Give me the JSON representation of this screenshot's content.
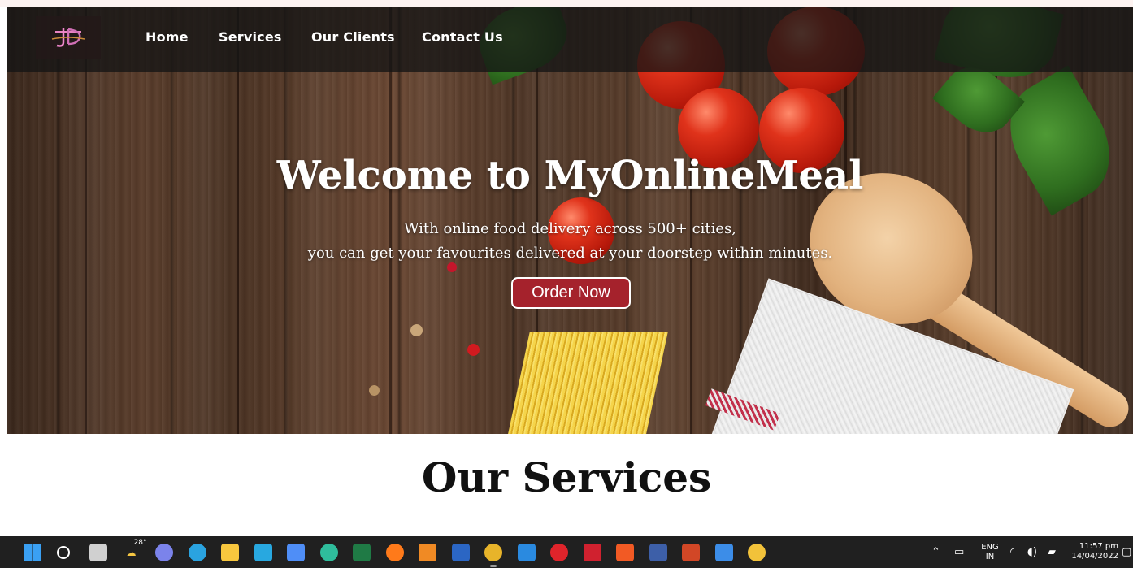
{
  "nav": {
    "items": [
      {
        "label": "Home"
      },
      {
        "label": "Services"
      },
      {
        "label": "Our Clients"
      },
      {
        "label": "Contact Us"
      }
    ]
  },
  "hero": {
    "title": "Welcome to MyOnlineMeal",
    "line1": "With online food delivery across 500+ cities,",
    "line2": "you can get your favourites delivered at your doorstep within minutes.",
    "cta_label": "Order Now"
  },
  "services": {
    "title": "Our Services"
  },
  "taskbar": {
    "weather_temp": "28°",
    "language_line1": "ENG",
    "language_line2": "IN",
    "time": "11:57 pm",
    "date": "14/04/2022",
    "apps": [
      {
        "icon": "windows-start-icon",
        "color": "#3aa0f3"
      },
      {
        "icon": "search-icon",
        "color": "#ffffff"
      },
      {
        "icon": "task-view-icon",
        "color": "#d0d0d0"
      },
      {
        "icon": "weather-icon",
        "color": "#f4c542"
      },
      {
        "icon": "chat-icon",
        "color": "#7b83eb"
      },
      {
        "icon": "telegram-icon",
        "color": "#2aa3e0"
      },
      {
        "icon": "file-explorer-icon",
        "color": "#f8c73e"
      },
      {
        "icon": "vscode-insiders-icon",
        "color": "#28a8e0"
      },
      {
        "icon": "store-icon",
        "color": "#4f8ef7"
      },
      {
        "icon": "edge-icon",
        "color": "#2fbd9c"
      },
      {
        "icon": "excel-icon",
        "color": "#1f7a45"
      },
      {
        "icon": "firefox-icon",
        "color": "#ff7a1a"
      },
      {
        "icon": "sublime-icon",
        "color": "#f08a24"
      },
      {
        "icon": "word-icon",
        "color": "#2b66c4"
      },
      {
        "icon": "chrome-dev-icon",
        "color": "#e8b42a"
      },
      {
        "icon": "vscode-icon",
        "color": "#2a8ae0"
      },
      {
        "icon": "opera-icon",
        "color": "#e0242b"
      },
      {
        "icon": "mcafee-icon",
        "color": "#d0212f"
      },
      {
        "icon": "brave-icon",
        "color": "#f25a24"
      },
      {
        "icon": "devhub-icon",
        "color": "#3d5fa8"
      },
      {
        "icon": "powerpoint-icon",
        "color": "#d24726"
      },
      {
        "icon": "todo-icon",
        "color": "#3c8de8"
      },
      {
        "icon": "chrome-icon",
        "color": "#f2c23a"
      }
    ]
  }
}
